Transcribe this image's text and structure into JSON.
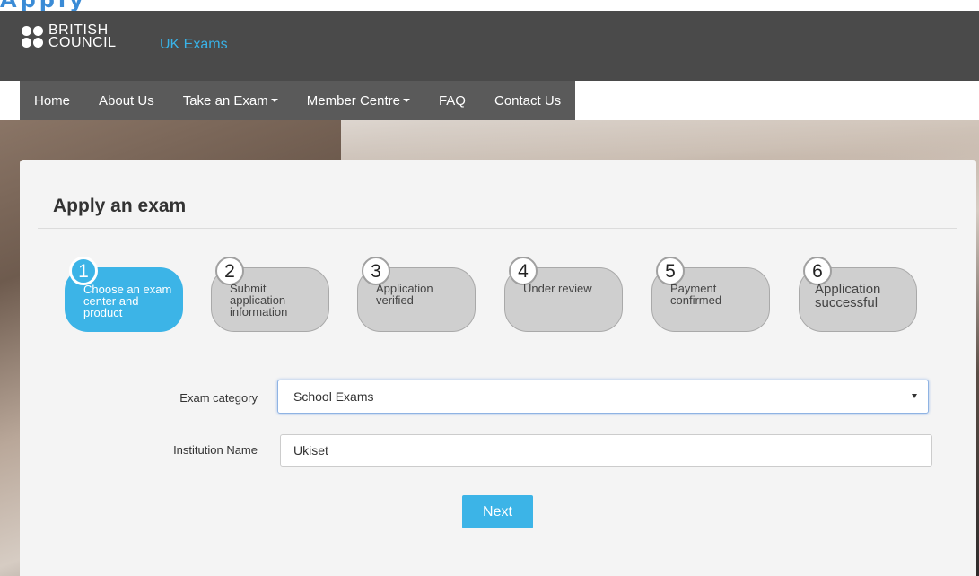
{
  "partial_title": "Apply",
  "header": {
    "logo_line1": "BRITISH",
    "logo_line2": "COUNCIL",
    "site_name": "UK Exams"
  },
  "nav": [
    {
      "label": "Home",
      "dropdown": false
    },
    {
      "label": "About Us",
      "dropdown": false
    },
    {
      "label": "Take an Exam",
      "dropdown": true
    },
    {
      "label": "Member Centre",
      "dropdown": true
    },
    {
      "label": "FAQ",
      "dropdown": false
    },
    {
      "label": "Contact Us",
      "dropdown": false
    }
  ],
  "page": {
    "title": "Apply an exam"
  },
  "steps": [
    {
      "number": "1",
      "label": "Choose an exam center and product",
      "active": true
    },
    {
      "number": "2",
      "label": "Submit application information",
      "active": false
    },
    {
      "number": "3",
      "label": "Application verified",
      "active": false
    },
    {
      "number": "4",
      "label": "Under review",
      "active": false
    },
    {
      "number": "5",
      "label": "Payment confirmed",
      "active": false
    },
    {
      "number": "6",
      "label": "Application successful",
      "active": false
    }
  ],
  "form": {
    "exam_category_label": "Exam category",
    "exam_category_value": "School Exams",
    "institution_label": "Institution Name",
    "institution_value": "Ukiset",
    "next_label": "Next"
  },
  "colors": {
    "accent": "#3cb4e7",
    "header_bg": "#4a4a4a",
    "nav_bg": "#5a5a5a",
    "site_name": "#39b3e8",
    "step_inactive": "#cfcfcf"
  }
}
